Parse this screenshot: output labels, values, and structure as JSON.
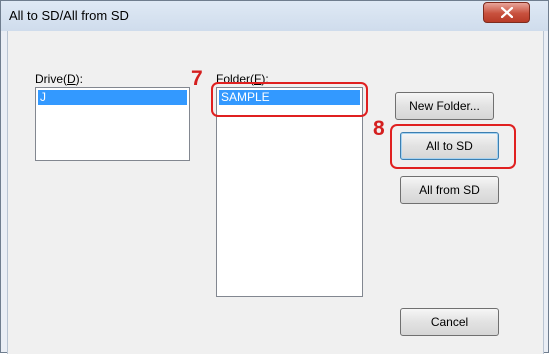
{
  "window": {
    "title": "All to SD/All from SD"
  },
  "drive": {
    "label_prefix": "Drive(",
    "label_key": "D",
    "label_suffix": "):",
    "items": [
      "J"
    ]
  },
  "folder": {
    "label_prefix": "Folder(",
    "label_key": "F",
    "label_suffix": "):",
    "items": [
      "SAMPLE"
    ]
  },
  "buttons": {
    "new_folder": "New Folder...",
    "all_to_sd": "All to SD",
    "all_from_sd": "All from SD",
    "cancel": "Cancel"
  },
  "annotations": {
    "step7": "7",
    "step8": "8",
    "color": "#d41f1f"
  },
  "icons": {
    "close": "close-icon"
  }
}
